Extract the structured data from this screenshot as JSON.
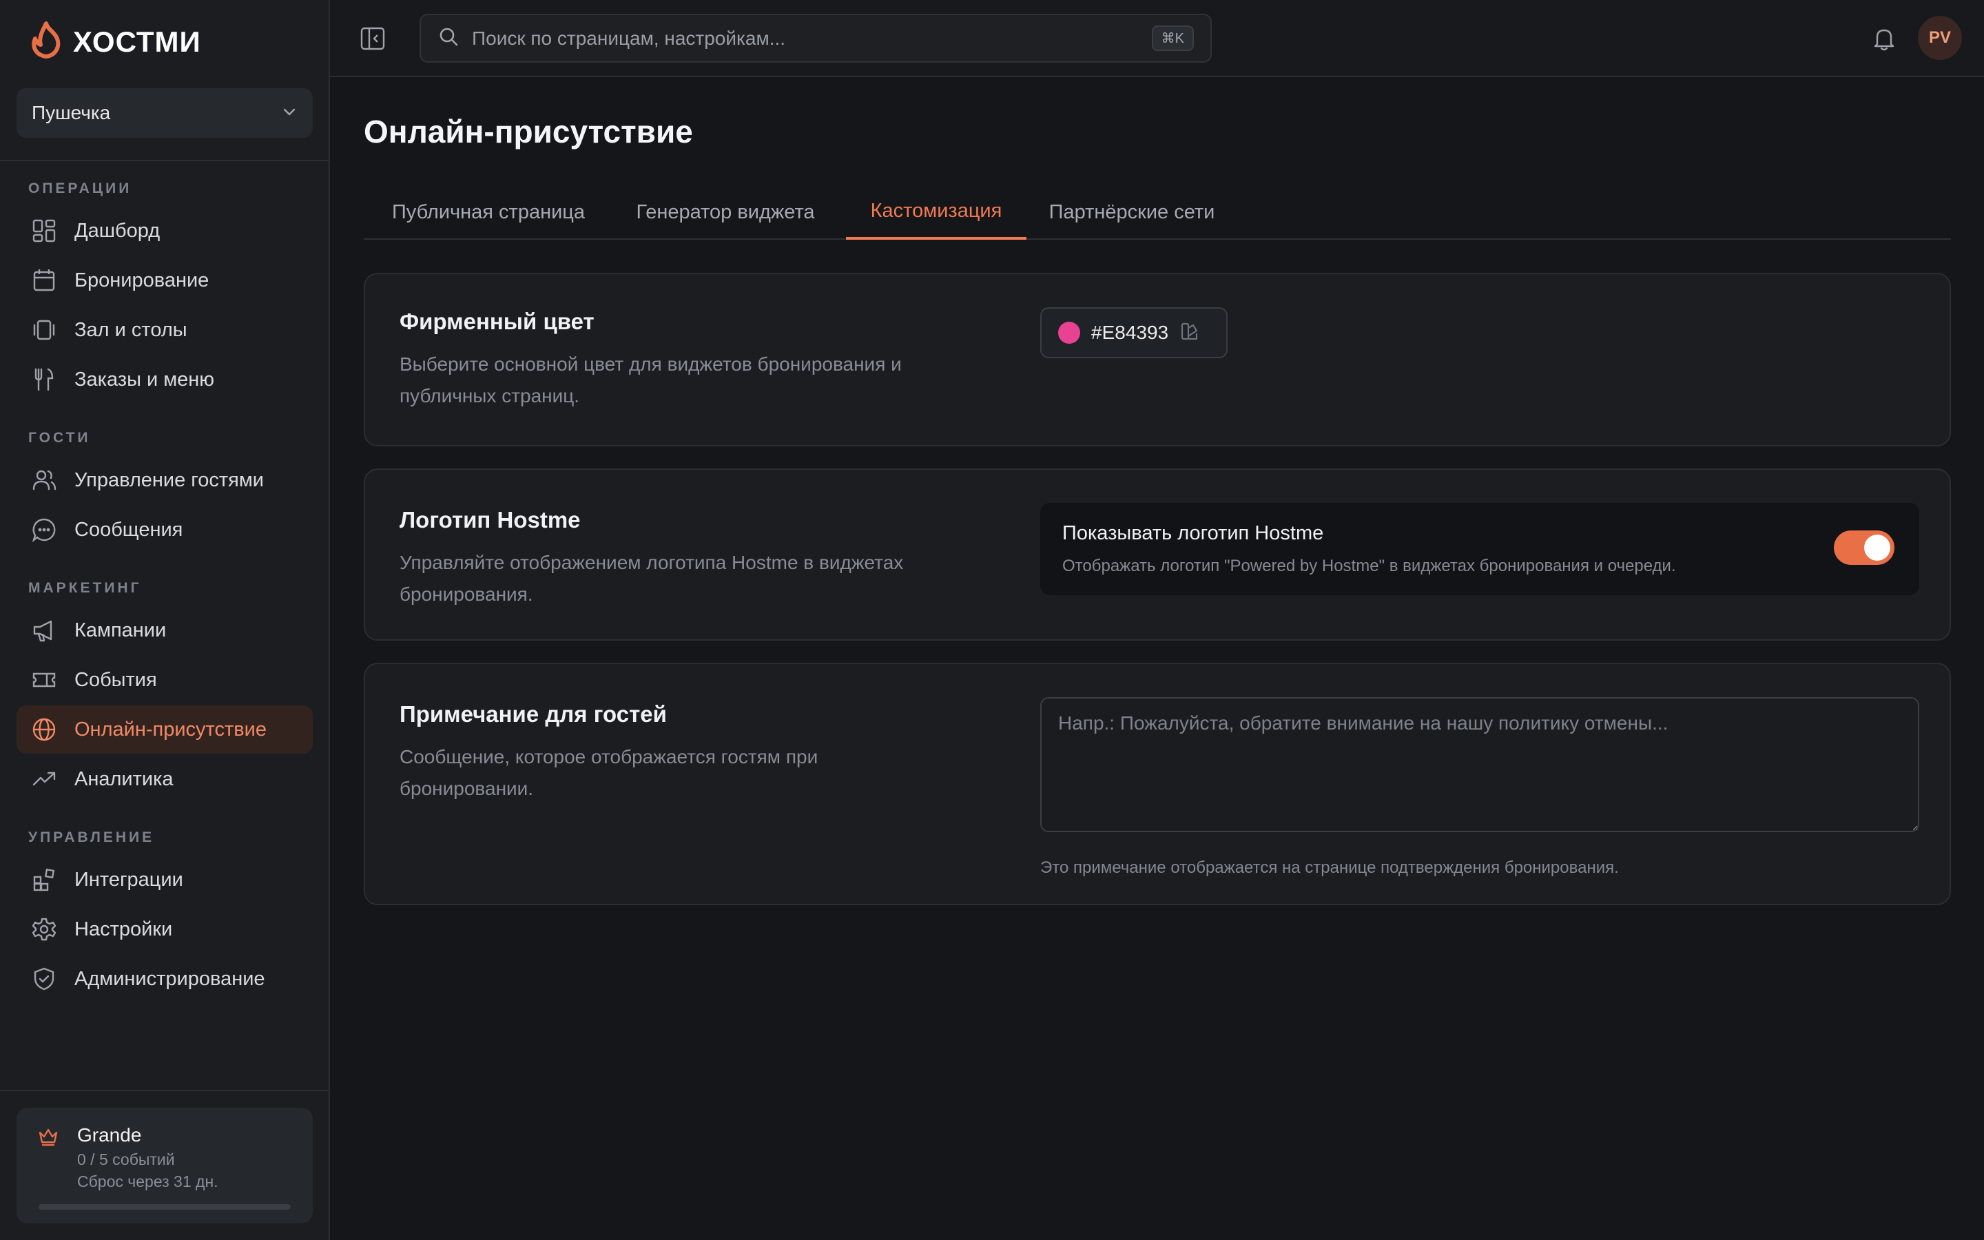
{
  "brand": {
    "name": "ХОСТМИ",
    "accent": "#E86F46"
  },
  "venue": {
    "selected": "Пушечка"
  },
  "sidebar": {
    "sections": [
      {
        "label": "ОПЕРАЦИИ",
        "items": [
          {
            "label": "Дашборд",
            "icon": "dashboard-icon"
          },
          {
            "label": "Бронирование",
            "icon": "calendar-icon"
          },
          {
            "label": "Зал и столы",
            "icon": "tables-icon"
          },
          {
            "label": "Заказы и меню",
            "icon": "utensils-icon"
          }
        ]
      },
      {
        "label": "ГОСТИ",
        "items": [
          {
            "label": "Управление гостями",
            "icon": "users-icon"
          },
          {
            "label": "Сообщения",
            "icon": "chat-icon"
          }
        ]
      },
      {
        "label": "МАРКЕТИНГ",
        "items": [
          {
            "label": "Кампании",
            "icon": "megaphone-icon"
          },
          {
            "label": "События",
            "icon": "ticket-icon"
          },
          {
            "label": "Онлайн-присутствие",
            "icon": "globe-icon",
            "active": true
          },
          {
            "label": "Аналитика",
            "icon": "trending-icon"
          }
        ]
      },
      {
        "label": "УПРАВЛЕНИЕ",
        "items": [
          {
            "label": "Интеграции",
            "icon": "integrations-icon"
          },
          {
            "label": "Настройки",
            "icon": "gear-icon"
          },
          {
            "label": "Администрирование",
            "icon": "shield-icon"
          }
        ]
      }
    ]
  },
  "plan": {
    "name": "Grande",
    "usage": "0 / 5 событий",
    "reset": "Сброс через 31 дн.",
    "progress": 0
  },
  "search": {
    "placeholder": "Поиск по страницам, настройкам...",
    "shortcut": "⌘K"
  },
  "user": {
    "initials": "PV"
  },
  "page": {
    "title": "Онлайн-присутствие"
  },
  "tabs": [
    {
      "label": "Публичная страница"
    },
    {
      "label": "Генератор виджета"
    },
    {
      "label": "Кастомизация",
      "active": true
    },
    {
      "label": "Партнёрские сети"
    }
  ],
  "brand_color": {
    "title": "Фирменный цвет",
    "description": "Выберите основной цвет для виджетов бронирования и публичных страниц.",
    "value": "#E84393"
  },
  "logo_setting": {
    "title": "Логотип Hostme",
    "description": "Управляйте отображением логотипа Hostme в виджетах бронирования.",
    "toggle_label": "Показывать логотип Hostme",
    "toggle_hint": "Отображать логотип \"Powered by Hostme\" в виджетах бронирования и очереди.",
    "enabled": true
  },
  "guest_note": {
    "title": "Примечание для гостей",
    "description": "Сообщение, которое отображается гостям при бронировании.",
    "placeholder": "Напр.: Пожалуйста, обратите внимание на нашу политику отмены...",
    "value": "",
    "hint": "Это примечание отображается на странице подтверждения бронирования."
  }
}
